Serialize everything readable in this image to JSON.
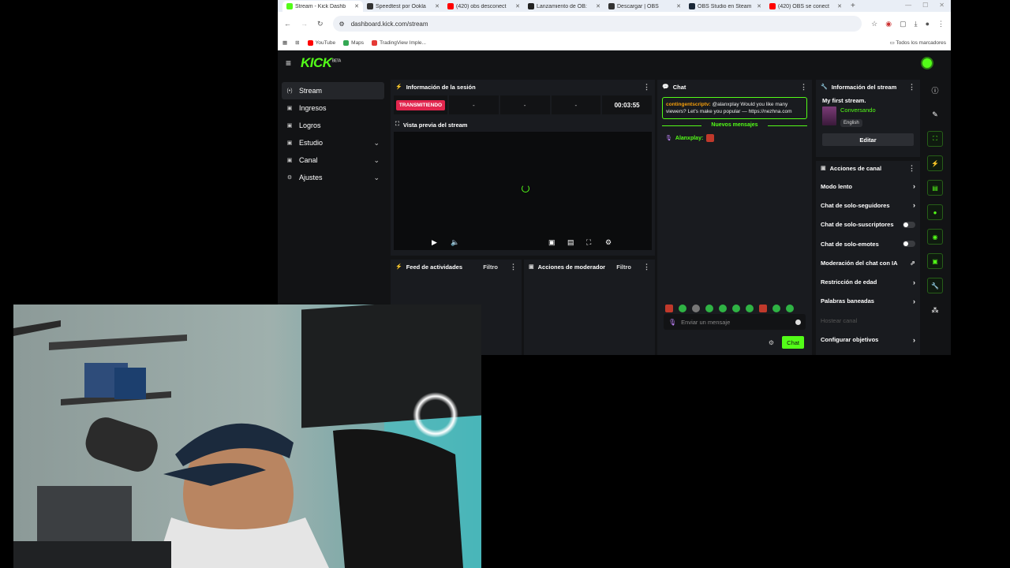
{
  "browser": {
    "tabs": [
      {
        "label": "Stream - Kick Dashb",
        "color": "#53fc18",
        "active": true
      },
      {
        "label": "Speedtest por Ookla",
        "color": "#333333"
      },
      {
        "label": "(420) obs desconect",
        "color": "#ff0000"
      },
      {
        "label": "Lanzamiento de OB:",
        "color": "#222222"
      },
      {
        "label": "Descargar | OBS",
        "color": "#333333"
      },
      {
        "label": "OBS Studio en Steam",
        "color": "#1b2838"
      },
      {
        "label": "(420) OBS se conect",
        "color": "#ff0000"
      }
    ],
    "tab_close": "✕",
    "new_tab": "+",
    "url": "dashboard.kick.com/stream",
    "bookmarks": [
      {
        "label": "YouTube",
        "color": "#ff0000"
      },
      {
        "label": "Maps",
        "color": "#34a853"
      },
      {
        "label": "TradingView Imple...",
        "color": "#e53935"
      }
    ],
    "all_bookmarks": "Todos los marcadores"
  },
  "kick": {
    "logo": "KICK",
    "logo_sup": "BETA",
    "nav": [
      {
        "label": "Stream",
        "icon": "(•)",
        "active": true,
        "expand": false
      },
      {
        "label": "Ingresos",
        "icon": "▣",
        "expand": false
      },
      {
        "label": "Logros",
        "icon": "▣",
        "expand": false
      },
      {
        "label": "Estudio",
        "icon": "▣",
        "expand": true
      },
      {
        "label": "Canal",
        "icon": "▣",
        "expand": true
      },
      {
        "label": "Ajustes",
        "icon": "⚙",
        "expand": true
      }
    ],
    "session": {
      "title": "Información de la sesión",
      "live_label": "TRANSMITIENDO",
      "stats": [
        "-",
        "-",
        "-"
      ],
      "time": "00:03:55"
    },
    "preview": {
      "title": "Vista previa del stream"
    },
    "activity": {
      "title": "Feed de actividades",
      "filter": "Filtro"
    },
    "modactions": {
      "title": "Acciones de moderador",
      "filter": "Filtro"
    },
    "chat": {
      "title": "Chat",
      "highlight_user": "contingentscriptv:",
      "highlight_text": "@alanxplay Would you like many viewers? Let's make you popular — https://nezhna.com",
      "new_messages": "Nuevos mensajes",
      "line_user": "Alanxplay:",
      "placeholder": "Enviar un mensaje",
      "send_label": "Chat"
    },
    "stream_info": {
      "title": "Información del stream",
      "stream_title": "My first stream.",
      "category": "Conversando",
      "language": "English",
      "edit_label": "Editar"
    },
    "channel_actions": {
      "title": "Acciones de canal",
      "items": [
        {
          "label": "Modo lento",
          "kind": "chevron"
        },
        {
          "label": "Chat de solo-seguidores",
          "kind": "chevron"
        },
        {
          "label": "Chat de solo-suscriptores",
          "kind": "toggle",
          "on": false
        },
        {
          "label": "Chat de solo-emotes",
          "kind": "toggle",
          "on": false
        },
        {
          "label": "Moderación del chat con IA",
          "kind": "external"
        },
        {
          "label": "Restricción de edad",
          "kind": "chevron"
        },
        {
          "label": "Palabras baneadas",
          "kind": "chevron"
        },
        {
          "label": "Hostear canal",
          "kind": "disabled"
        },
        {
          "label": "Configurar objetivos",
          "kind": "chevron"
        }
      ]
    }
  }
}
